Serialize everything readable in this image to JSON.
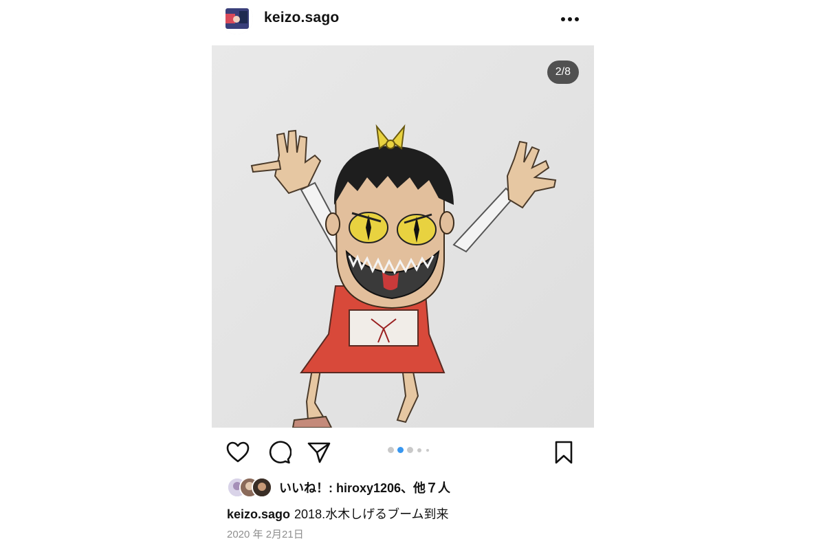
{
  "post": {
    "username": "keizo.sago",
    "media": {
      "counter": "2/8",
      "description": "Crayon drawing of a girl with bob haircut, yellow bow, yellow cat-like eyes, open mouth with sharp teeth, red pinafore dress, arms raised",
      "carousel_dots": 5,
      "active_dot_index": 1
    },
    "actions": {
      "like_icon": "heart-icon",
      "comment_icon": "comment-icon",
      "share_icon": "send-icon",
      "save_icon": "bookmark-icon"
    },
    "likes_text": "いいね！: hiroxy1206、他７人",
    "caption_user": "keizo.sago",
    "caption_text": "2018.水木しげるブーム到来",
    "date": "2020 年 2月21日"
  },
  "colors": {
    "accent_dot": "#3897f0",
    "inactive_dot": "#c9c9c9",
    "date_gray": "#8e8e8e",
    "dress_red": "#d8493a",
    "eye_yellow": "#e8d240"
  }
}
